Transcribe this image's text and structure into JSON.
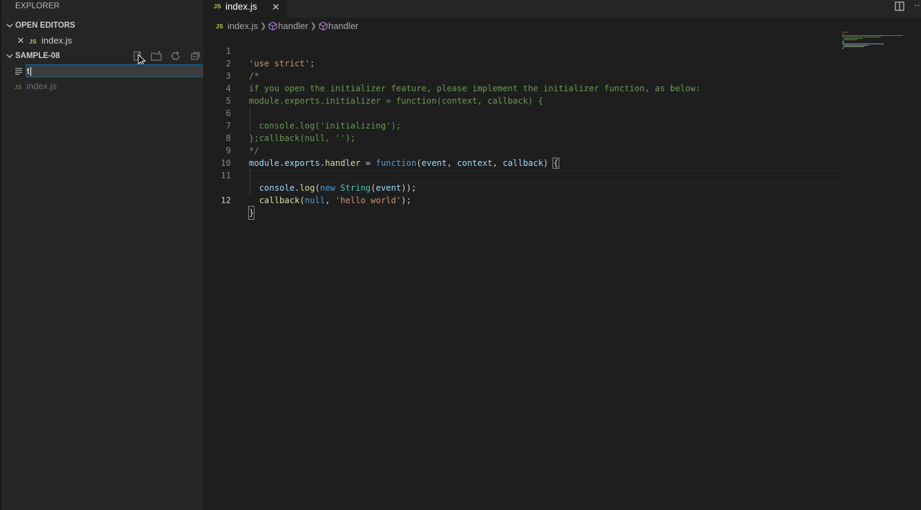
{
  "sidebar": {
    "title": "EXPLORER",
    "open_editors": {
      "header": "OPEN EDITORS",
      "items": [
        {
          "badge": "JS",
          "name": "index.js"
        }
      ]
    },
    "folder": {
      "header": "SAMPLE-08",
      "new_file_input_value": "t",
      "files": [
        {
          "badge": "JS",
          "name": "index.js"
        }
      ]
    }
  },
  "editor": {
    "tab": {
      "badge": "JS",
      "label": "index.js"
    },
    "breadcrumb": {
      "badge": "JS",
      "file": "index.js",
      "symbol1": "handler",
      "symbol2": "handler"
    },
    "line_numbers": [
      "1",
      "2",
      "3",
      "4",
      "5",
      "6",
      "7",
      "8",
      "9",
      "10",
      "11",
      "12"
    ],
    "active_line": "12",
    "code": {
      "l1": "'use strict';",
      "l2": "/*",
      "l3": "if you open the initializer feature, please implement the initializer function, as below:",
      "l4": "module.exports.initializer = function(context, callback) {",
      "l5": "  console.log('initializing');",
      "l6": "  callback(null, '');",
      "l7": "};",
      "l8": "*/",
      "l9": {
        "module": "module",
        "dot1": ".",
        "exports": "exports",
        "dot2": ".",
        "handler": "handler",
        "eq": " = ",
        "function": "function",
        "p1": "(",
        "event": "event",
        "c1": ", ",
        "context": "context",
        "c2": ", ",
        "callback": "callback",
        "p2": ") ",
        "brace": "{"
      },
      "l10": {
        "indent": "  ",
        "console": "console",
        "dot": ".",
        "log": "log",
        "p1": "(",
        "new": "new",
        "sp": " ",
        "String": "String",
        "p2": "(",
        "event": "event",
        "p3": "));"
      },
      "l11": {
        "indent": "  ",
        "callback": "callback",
        "p1": "(",
        "null": "null",
        "c": ", ",
        "str": "'hello world'",
        "p2": ");"
      },
      "l12": "}"
    }
  }
}
